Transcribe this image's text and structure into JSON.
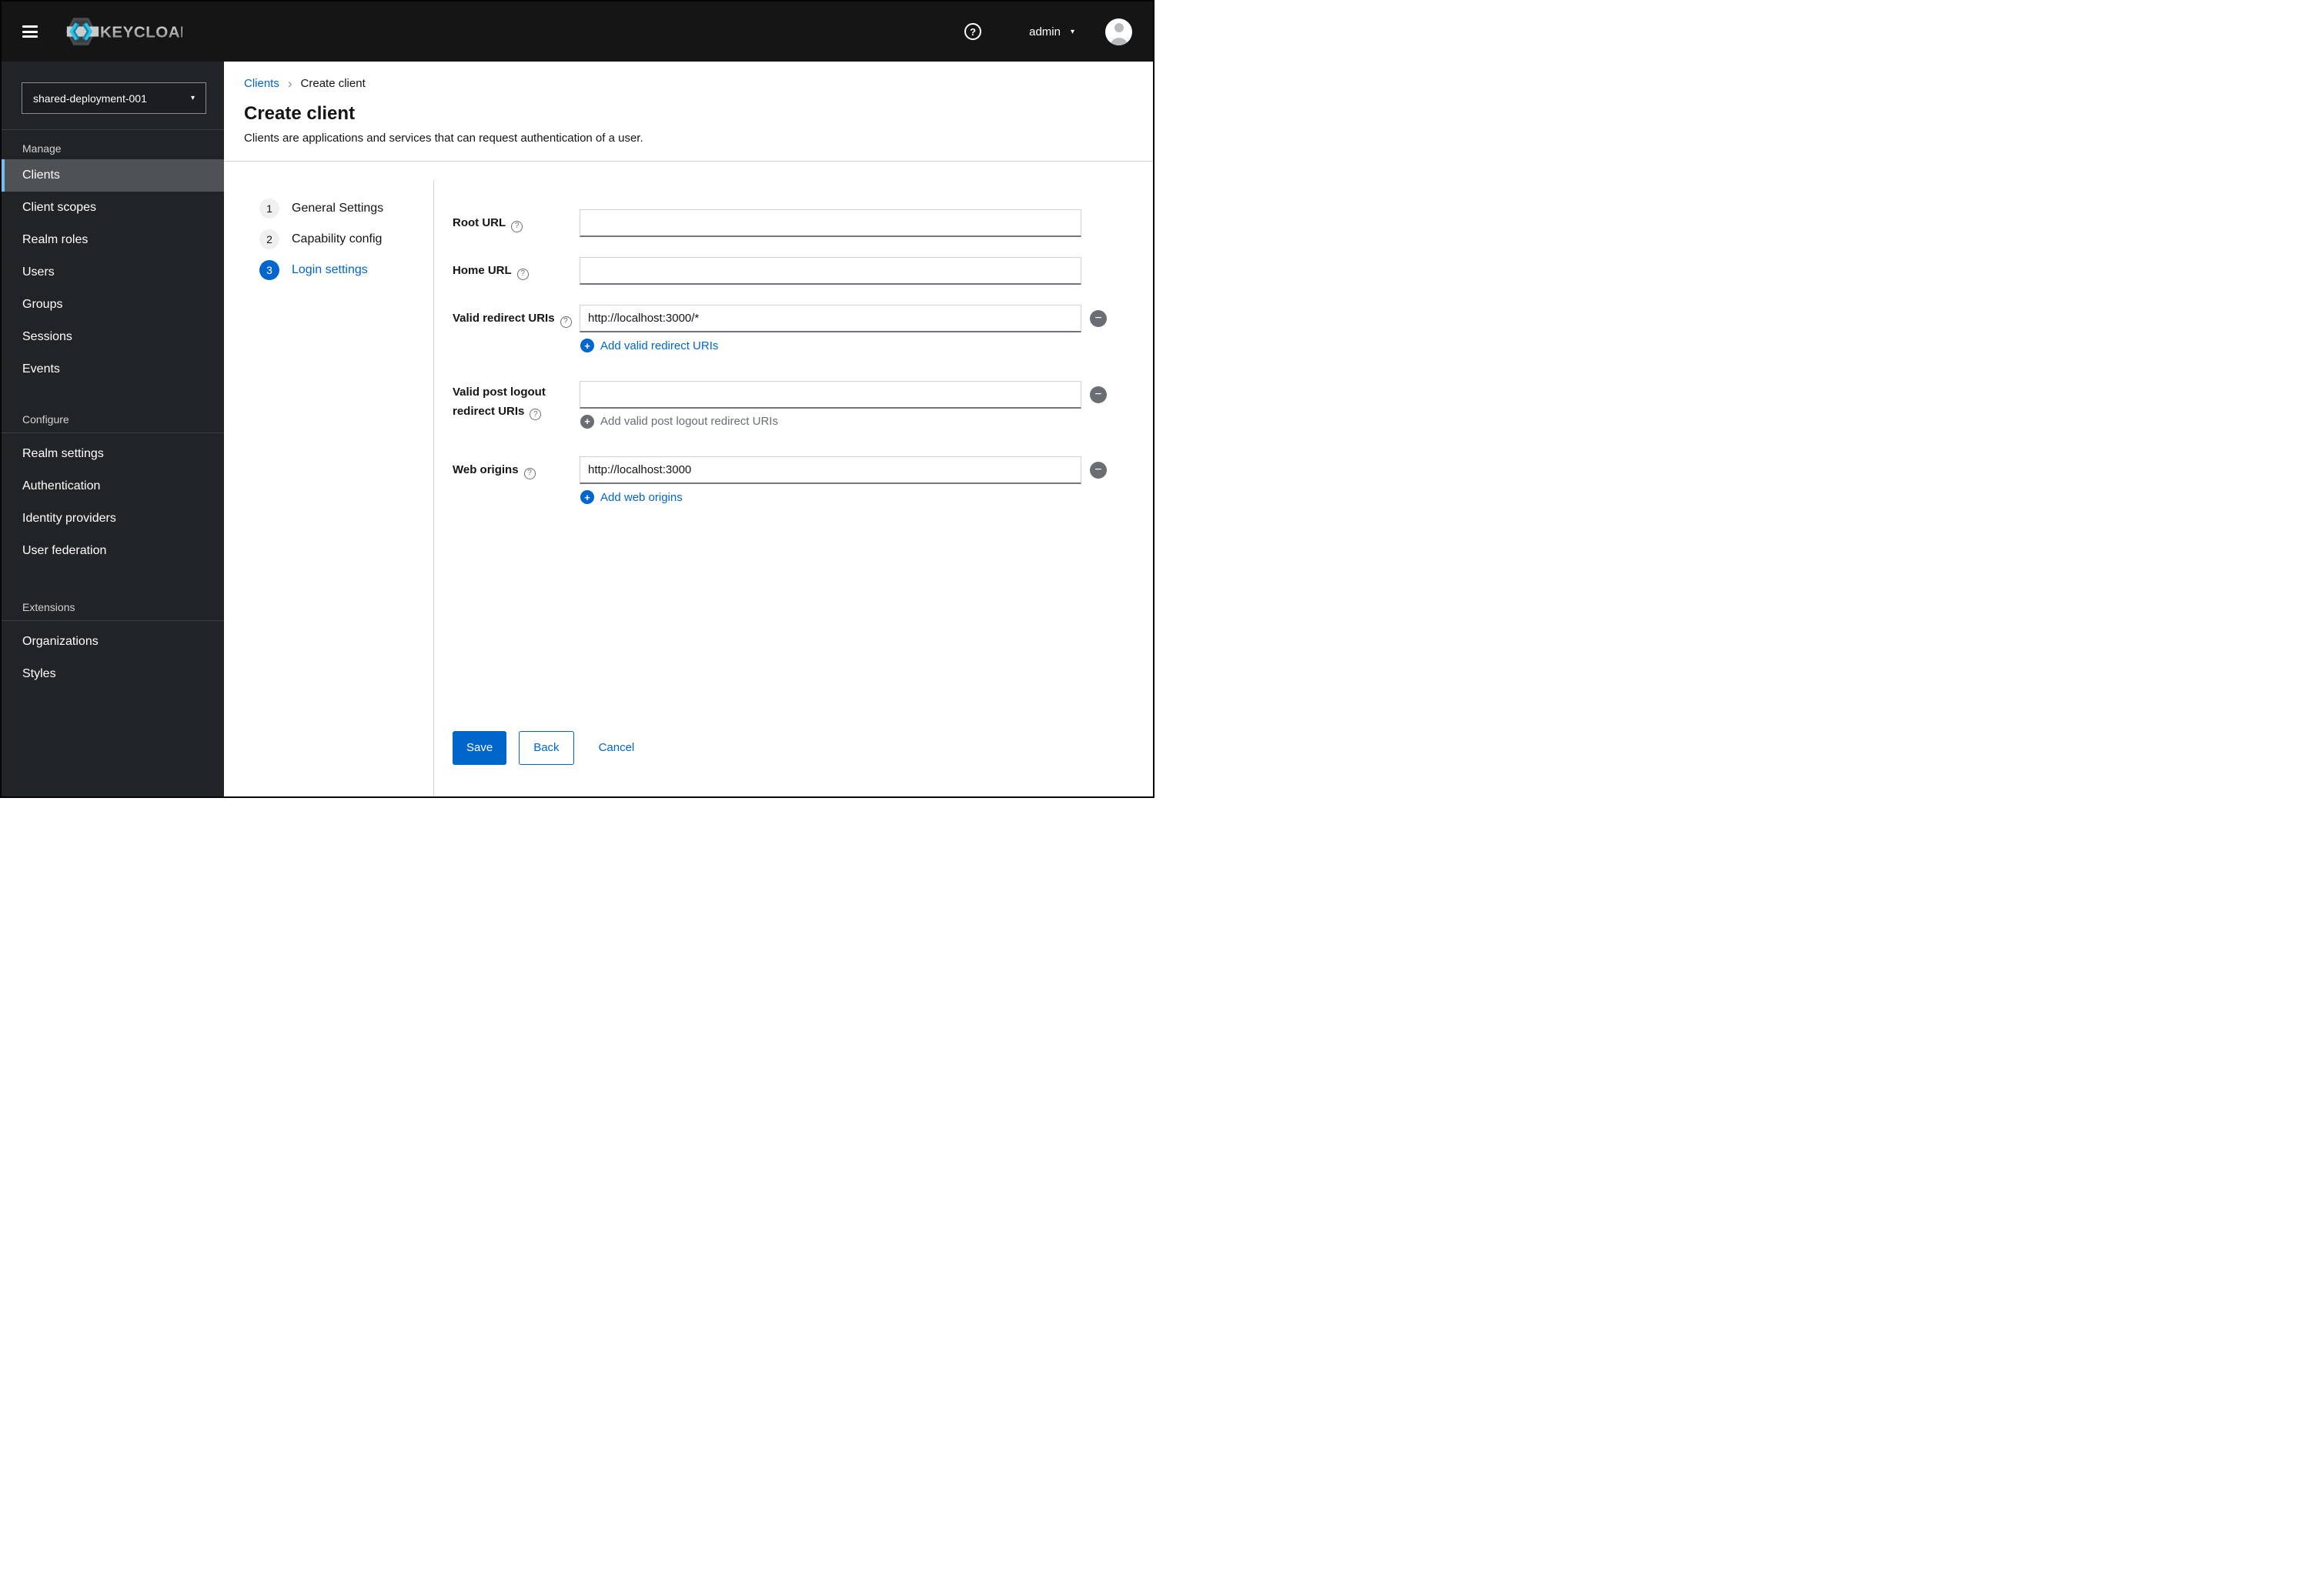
{
  "icons": {
    "help": "?",
    "plus": "+",
    "minus": "−",
    "caret_down": "▾",
    "breadcrumb_sep": "›"
  },
  "masthead": {
    "brand": "KEYCLOAK",
    "user": "admin"
  },
  "sidebar": {
    "realm": "shared-deployment-001",
    "sections": [
      {
        "label": "Manage",
        "items": [
          {
            "label": "Clients"
          },
          {
            "label": "Client scopes"
          },
          {
            "label": "Realm roles"
          },
          {
            "label": "Users"
          },
          {
            "label": "Groups"
          },
          {
            "label": "Sessions"
          },
          {
            "label": "Events"
          }
        ]
      },
      {
        "label": "Configure",
        "items": [
          {
            "label": "Realm settings"
          },
          {
            "label": "Authentication"
          },
          {
            "label": "Identity providers"
          },
          {
            "label": "User federation"
          }
        ]
      },
      {
        "label": "Extensions",
        "items": [
          {
            "label": "Organizations"
          },
          {
            "label": "Styles"
          }
        ]
      }
    ]
  },
  "breadcrumb": {
    "parent": "Clients",
    "current": "Create client"
  },
  "header": {
    "title": "Create client",
    "subtitle": "Clients are applications and services that can request authentication of a user."
  },
  "wizard": {
    "steps": [
      {
        "num": "1",
        "label": "General Settings"
      },
      {
        "num": "2",
        "label": "Capability config"
      },
      {
        "num": "3",
        "label": "Login settings"
      }
    ]
  },
  "form": {
    "fields": [
      {
        "label": "Root URL",
        "value": ""
      },
      {
        "label": "Home URL",
        "value": ""
      },
      {
        "label": "Valid redirect URIs",
        "value": "http://localhost:3000/*",
        "add": "Add valid redirect URIs"
      },
      {
        "label": "Valid post logout redirect URIs",
        "value": "",
        "add": "Add valid post logout redirect URIs"
      },
      {
        "label": "Web origins",
        "value": "http://localhost:3000",
        "add": "Add web origins"
      }
    ]
  },
  "actions": {
    "save": "Save",
    "back": "Back",
    "cancel": "Cancel"
  },
  "colors": {
    "accent": "#0066cc",
    "masthead_bg": "#151515",
    "sidebar_bg": "#212427",
    "selected_bg": "#4f5255",
    "selected_border": "#73bcf7",
    "muted": "#6a6e73",
    "divider": "#d2d2d2"
  }
}
